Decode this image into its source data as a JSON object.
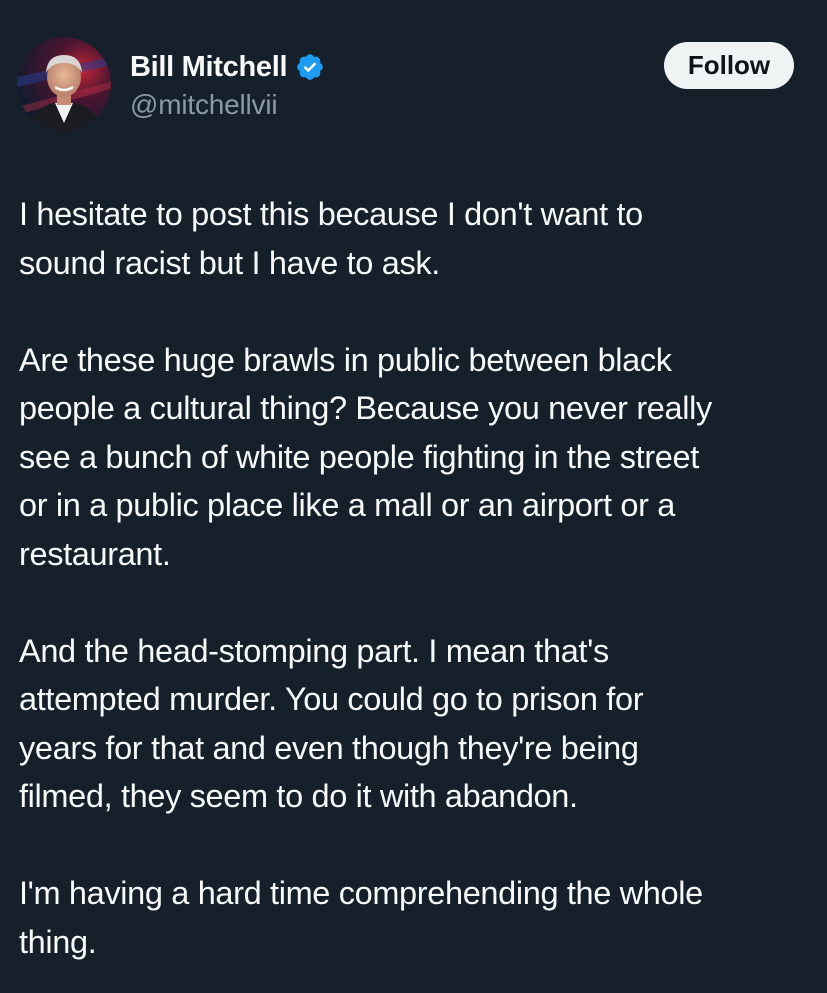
{
  "author": {
    "display_name": "Bill Mitchell",
    "handle": "@mitchellvii",
    "verified": true,
    "verified_badge_color": "#1d9bf0",
    "avatar_icon": "profile-photo"
  },
  "actions": {
    "follow_label": "Follow"
  },
  "tweet": {
    "paragraphs": [
      "I hesitate to post this because I don't want to\nsound racist but I have to ask.",
      "Are these huge brawls in public between black\npeople a cultural thing? Because you never really\nsee a bunch of white people fighting in the street\nor in a public place like a mall or an airport or a\nrestaurant.",
      "And the head-stomping part. I mean that's\nattempted murder. You could go to prison for\nyears for that and even though they're being\nfilmed, they seem to do it with abandon.",
      "I'm having a hard time comprehending the whole\nthing."
    ]
  },
  "colors": {
    "background": "#15202b",
    "text_primary": "#f7f9f9",
    "text_secondary": "#8b98a5",
    "button_bg": "#eff3f4"
  }
}
